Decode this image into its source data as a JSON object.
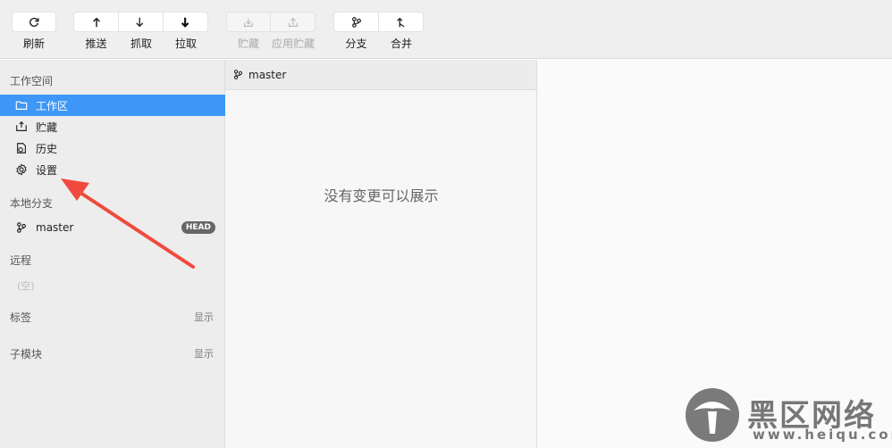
{
  "toolbar": {
    "refresh": "刷新",
    "push": "推送",
    "fetch": "抓取",
    "pull": "拉取",
    "stash": "贮藏",
    "apply_stash": "应用贮藏",
    "branch": "分支",
    "merge": "合并"
  },
  "sidebar": {
    "workspace_title": "工作空间",
    "items": [
      {
        "label": "工作区",
        "icon": "folder-icon",
        "active": true
      },
      {
        "label": "贮藏",
        "icon": "stash-icon"
      },
      {
        "label": "历史",
        "icon": "history-icon"
      },
      {
        "label": "设置",
        "icon": "gear-icon"
      }
    ],
    "local_branches_title": "本地分支",
    "branch": {
      "name": "master",
      "badge": "HEAD"
    },
    "remote_title": "远程",
    "remote_empty": "(空)",
    "tags_title": "标签",
    "tags_action": "显示",
    "submodules_title": "子模块",
    "submodules_action": "显示"
  },
  "middle": {
    "branch_name": "master",
    "empty_message": "没有变更可以展示"
  },
  "watermark": {
    "name": "黑区网络",
    "url": "www.heiqu.com"
  },
  "colors": {
    "accent": "#3e97f7",
    "annotation_arrow": "#f04a3e"
  }
}
